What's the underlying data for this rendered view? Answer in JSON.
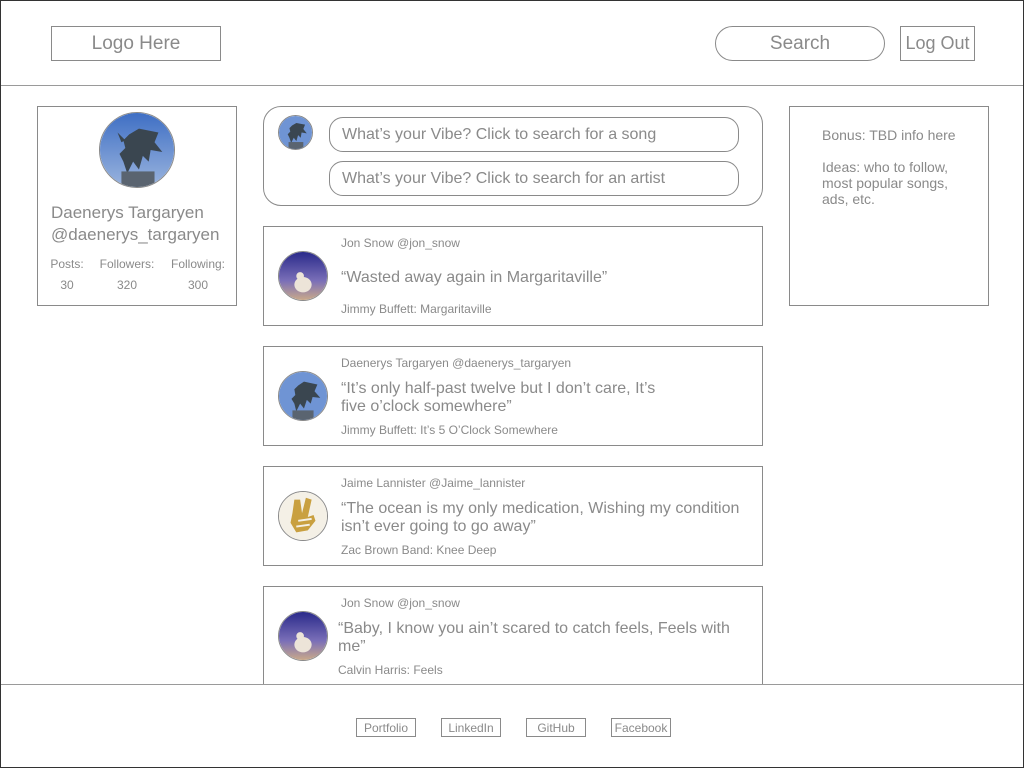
{
  "header": {
    "logo": "Logo Here",
    "search_label": "Search",
    "logout_label": "Log Out"
  },
  "profile": {
    "name": "Daenerys Targaryen",
    "handle": "@daenerys_targaryen",
    "avatar_icon": "dragon-avatar-icon",
    "stats": [
      {
        "label": "Posts:",
        "value": "30"
      },
      {
        "label": "Followers:",
        "value": "320"
      },
      {
        "label": "Following:",
        "value": "300"
      }
    ]
  },
  "composer": {
    "avatar_icon": "dragon-avatar-icon",
    "song_placeholder": "What’s your Vibe? Click to search for a song",
    "artist_placeholder": "What’s your Vibe? Click to search for an artist"
  },
  "feed": [
    {
      "author": "Jon Snow @jon_snow",
      "quote_lines": [
        "“Wasted away again in Margaritaville”"
      ],
      "song": "Jimmy Buffett: Margaritaville",
      "avatar_icon": "wolf-avatar-icon"
    },
    {
      "author": "Daenerys Targaryen @daenerys_targaryen",
      "quote_lines": [
        "“It’s only half-past twelve but I don’t care, It’s",
        "five o’clock somewhere”"
      ],
      "song": "Jimmy Buffett: It’s 5 O’Clock Somewhere",
      "avatar_icon": "dragon-avatar-icon"
    },
    {
      "author": "Jaime Lannister @Jaime_lannister",
      "quote_lines": [
        "“The ocean is my only medication, Wishing my condition",
        "isn’t ever going to go away”"
      ],
      "song": "Zac Brown Band: Knee Deep",
      "avatar_icon": "golden-hand-avatar-icon"
    },
    {
      "author": "Jon Snow @jon_snow",
      "quote_lines": [
        "“Baby, I know you ain’t scared to catch feels, Feels with",
        "me”"
      ],
      "song": "Calvin Harris: Feels",
      "avatar_icon": "wolf-avatar-icon"
    }
  ],
  "side_panel": {
    "bonus": "Bonus: TBD info here",
    "ideas": "Ideas: who to follow, most popular songs, ads, etc."
  },
  "footer": {
    "links": [
      "Portfolio",
      "LinkedIn",
      "GitHub",
      "Facebook"
    ]
  },
  "colors": {
    "text": "#8a8a8a",
    "border": "#8a8a8a",
    "background": "#ffffff"
  }
}
